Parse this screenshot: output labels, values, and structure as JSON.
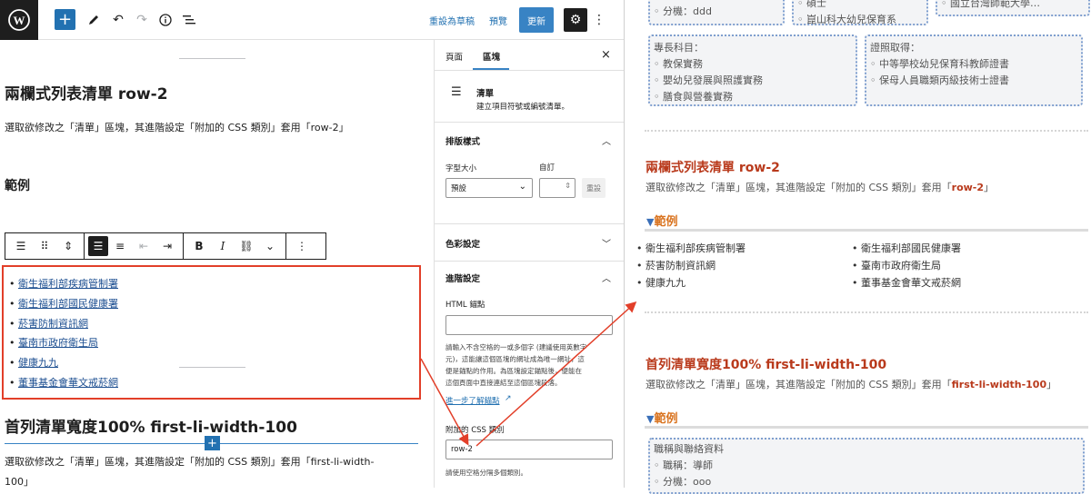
{
  "toolbar": {
    "draft_label": "重設為草稿",
    "preview_label": "預覽",
    "update_label": "更新"
  },
  "editor": {
    "section1_title": "兩欄式列表清單 row-2",
    "section1_desc": "選取欲修改之「清單」區塊，其進階設定「附加的 CSS 類別」套用「row-2」",
    "example_heading": "範例",
    "list_items": [
      "衛生福利部疾病管制署",
      "衛生福利部國民健康署",
      "菸害防制資訊網",
      "臺南市政府衛生局",
      "健康九九",
      "董事基金會華文戒菸網"
    ],
    "section2_title": "首列清單寬度100% first-li-width-100",
    "section2_desc_line1": "選取欲修改之「清單」區塊，其進階設定「附加的 CSS 類別」套用「first-li-width-",
    "section2_desc_line2": "100」"
  },
  "sidebar": {
    "tab_page": "頁面",
    "tab_block": "區塊",
    "block_name": "清單",
    "block_desc": "建立項目符號或編號清單。",
    "typography_title": "排版樣式",
    "font_size_label": "字型大小",
    "custom_label": "自訂",
    "font_size_value": "預設",
    "reset_label": "重設",
    "color_title": "色彩設定",
    "advanced_title": "進階設定",
    "html_anchor_label": "HTML 錨點",
    "html_anchor_help": [
      "請輸入不含空格的一或多個字 (建議使用英數字",
      "元)，這能讓這個區塊的網址成為唯一網址，這",
      "便是錨點的作用。為區塊設定錨點後，便能在",
      "這個頁面中直接連結至這個區塊段落。"
    ],
    "learn_more_label": "進一步了解錨點",
    "css_class_label": "附加的 CSS 類別",
    "css_class_value": "row-2",
    "css_class_help": "請使用空格分隔多個類別。"
  },
  "preview": {
    "top_box_left": "分機：ddd",
    "top_box_mid1": "碩士",
    "top_box_mid2": "崑山科大幼兒保育系",
    "top_box_right": "國立台灣師範大學…",
    "box1_title": "專長科目：",
    "box1_items": [
      "教保實務",
      "嬰幼兒發展與照護實務",
      "膳食與營養實務"
    ],
    "box2_title": "證照取得：",
    "box2_items": [
      "中等學校幼兒保育科教師證書",
      "保母人員職類丙級技術士證書"
    ],
    "section1_title": "兩欄式列表清單 row-2",
    "section1_desc_pre": "選取欲修改之「清單」區塊，其進階設定「附加的 CSS 類別」套用「",
    "section1_desc_code": "row-2",
    "section1_desc_post": "」",
    "example_label": "範例",
    "col1": [
      "衛生福利部疾病管制署",
      "菸害防制資訊網",
      "健康九九"
    ],
    "col2": [
      "衛生福利部國民健康署",
      "臺南市政府衛生局",
      "董事基金會華文戒菸網"
    ],
    "section2_title": "首列清單寬度100% first-li-width-100",
    "section2_desc_pre": "選取欲修改之「清單」區塊，其進階設定「附加的 CSS 類別」套用「",
    "section2_desc_code": "first-li-width-100",
    "section2_desc_post": "」",
    "example2_label": "範例",
    "box3_title": "職稱與聯絡資料",
    "box3_items": [
      "職稱：導師",
      "分機：ooo"
    ]
  },
  "colors": {
    "accent": "#2271b1",
    "highlight": "#e23f29",
    "heading_red": "#b93a1c",
    "example_orange": "#d9731f"
  }
}
